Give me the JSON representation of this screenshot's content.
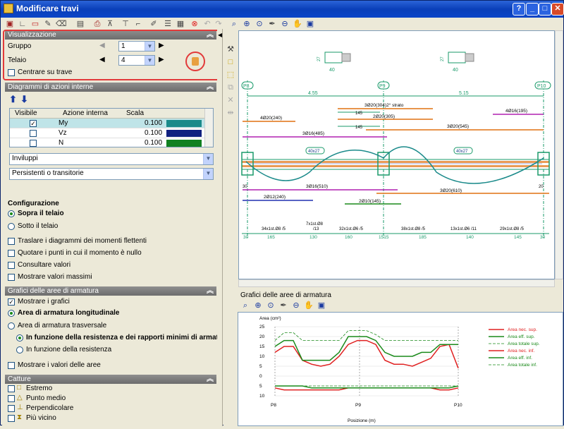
{
  "window": {
    "title": "Modificare travi"
  },
  "sections": {
    "visualizzazione": "Visualizzazione",
    "diagrammi": "Diagrammi di azioni interne",
    "grafici": "Grafici delle aree di armatura",
    "catture": "Catture"
  },
  "visual": {
    "gruppo_label": "Gruppo",
    "gruppo_value": "1",
    "telaio_label": "Telaio",
    "telaio_value": "4",
    "centrare": "Centrare su trave"
  },
  "table": {
    "headers": [
      "Visibile",
      "Azione interna",
      "Scala"
    ],
    "rows": [
      {
        "checked": true,
        "name": "My",
        "scale": "0.100",
        "color": "#1a8a8a"
      },
      {
        "checked": false,
        "name": "Vz",
        "scale": "0.100",
        "color": "#102080"
      },
      {
        "checked": false,
        "name": "N",
        "scale": "0.100",
        "color": "#108020"
      }
    ]
  },
  "combos": {
    "inviluppi": "Inviluppi",
    "persistenti": "Persistenti o transitorie"
  },
  "config": {
    "title": "Configurazione",
    "sopra": "Sopra il telaio",
    "sotto": "Sotto il telaio",
    "traslare": "Traslare i diagrammi dei momenti flettenti",
    "quotare": "Quotare i punti in cui il momento è nullo",
    "consultare": "Consultare valori",
    "mostrare_max": "Mostrare valori massimi"
  },
  "grafici": {
    "mostrare": "Mostrare i grafici",
    "longitudinale": "Area di armatura longitudinale",
    "trasversale": "Area di armatura trasversale",
    "in_funzione_res_min": "In funzione della resistenza e dei rapporti minimi di armatura",
    "in_funzione_res": "In funzione della resistenza",
    "mostrare_valori": "Mostrare i valori delle aree"
  },
  "catture": {
    "items": [
      "Estremo",
      "Punto medio",
      "Perpendicolare",
      "Più vicino"
    ]
  },
  "drawing": {
    "nodes": [
      "P8",
      "P9",
      "P10"
    ],
    "spans": [
      "4.55",
      "5.15"
    ],
    "section_width": "40",
    "section_height": "27",
    "bars": {
      "top1": "3Ø20(304)2° strato",
      "b145a": "145",
      "top2": "2Ø20(305)",
      "b145b": "145",
      "top3": "4Ø20(240)",
      "top4": "4Ø16(195)",
      "top5": "3Ø16(485)",
      "top6": "3Ø20(545)",
      "sec1": "40x27",
      "sec2": "40x27",
      "bot1": "3Ø16(510)",
      "bot2": "3Ø20(610)",
      "bot3": "2Ø12(240)",
      "bot4": "2Ø10(145)",
      "left30a": "30",
      "right20": "20",
      "st1": "34x1st.Ø8 /5",
      "st2": "7x1st.Ø8",
      "st2b": "/13",
      "st3": "32x1st.Ø6 /5",
      "st4": "38x1st.Ø8 /5",
      "st5": "13x1st.Ø6 /11",
      "st6": "29x1st.Ø8 /5",
      "d1": "30",
      "d2": "165",
      "d3": "130",
      "d4": "160",
      "d5": "1515",
      "d6": "185",
      "d7": "140",
      "d8": "145",
      "d9": "30"
    }
  },
  "chart_title": "Grafici delle aree di armatura",
  "chart_data": {
    "type": "line",
    "ylabel": "Area (cm²)",
    "xlabel": "Posizione (m)",
    "x_ticks": [
      "P8",
      "P9",
      "P10"
    ],
    "y_ticks": [
      25,
      20,
      15,
      10,
      5,
      0,
      5,
      10
    ],
    "ylim": [
      -10,
      25
    ],
    "series": [
      {
        "name": "Area nec. sup.",
        "color": "#e02020",
        "values": [
          12,
          15,
          15,
          8,
          6,
          5,
          6,
          10,
          16,
          18,
          18,
          16,
          8,
          6,
          6,
          5,
          7,
          9,
          15,
          16,
          4
        ]
      },
      {
        "name": "Area eff. sup.",
        "color": "#1a8a1a",
        "values": [
          15,
          18,
          18,
          8,
          8,
          8,
          8,
          12,
          20,
          20,
          20,
          18,
          12,
          10,
          10,
          10,
          12,
          12,
          16,
          16,
          16
        ]
      },
      {
        "name": "Area totale sup.",
        "color": "#1a8a1a",
        "values": [
          18,
          22,
          22,
          18,
          18,
          18,
          18,
          18,
          23,
          23,
          23,
          21,
          18,
          18,
          18,
          18,
          18,
          18,
          18,
          18,
          18
        ]
      },
      {
        "name": "Area nec. inf.",
        "color": "#e02020",
        "values": [
          -6,
          -7,
          -7,
          -7,
          -7,
          -7,
          -7,
          -7,
          -6,
          -6,
          -6,
          -6,
          -6,
          -6,
          -6,
          -6,
          -6,
          -6,
          -7,
          -7,
          -6
        ]
      },
      {
        "name": "Area eff. inf.",
        "color": "#1a8a1a",
        "values": [
          -5,
          -5,
          -5,
          -5,
          -6,
          -6,
          -6,
          -6,
          -6,
          -6,
          -6,
          -6,
          -6,
          -6,
          -6,
          -6,
          -6,
          -6,
          -6,
          -6,
          -5
        ]
      },
      {
        "name": "Area totale inf.",
        "color": "#1a8a1a",
        "values": [
          -5,
          -5,
          -5,
          -5,
          -5,
          -5,
          -5,
          -5,
          -5,
          -5,
          -5,
          -5,
          -5,
          -5,
          -5,
          -5,
          -5,
          -5,
          -5,
          -5,
          -5
        ]
      }
    ]
  }
}
